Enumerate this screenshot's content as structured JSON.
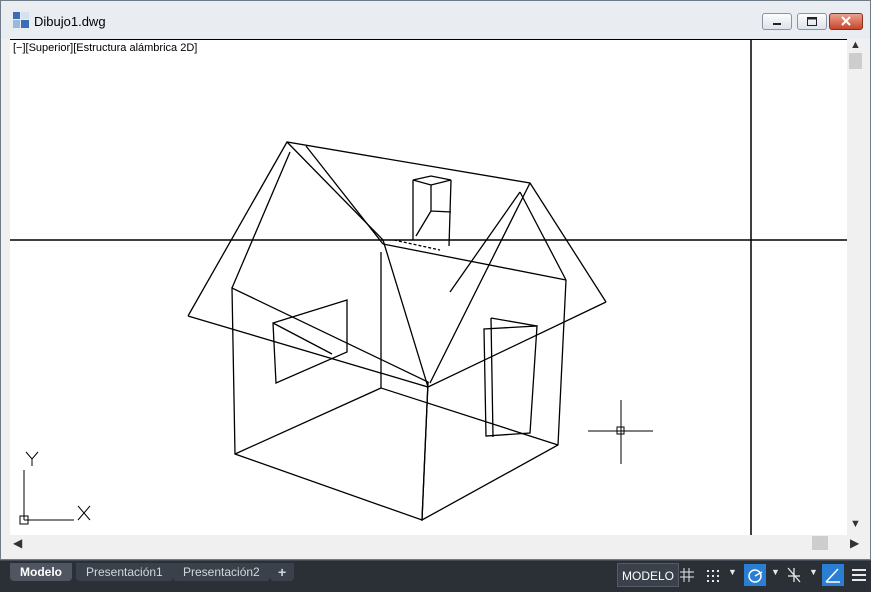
{
  "window": {
    "title": "Dibujo1.dwg",
    "icons": {
      "app": "autocad-drawing-icon",
      "minimize": "minimize-icon",
      "maximize": "maximize-icon",
      "close": "close-icon"
    }
  },
  "viewport": {
    "label": "[−][Superior][Estructura alámbrica 2D]",
    "content": "house-wireframe-drawing",
    "ucs": {
      "x_label": "X",
      "y_label": "Y"
    }
  },
  "scrollbars": {
    "up": "▲",
    "down": "▼",
    "left": "◀",
    "right": "▶"
  },
  "statusbar": {
    "tabs": [
      {
        "label": "Modelo",
        "active": true
      },
      {
        "label": "Presentación1",
        "active": false
      },
      {
        "label": "Presentación2",
        "active": false
      }
    ],
    "add_tab": "+",
    "model_button": "MODELO",
    "tools": [
      "grid-icon",
      "snap-icon",
      "ortho-icon",
      "polar-tracking-icon",
      "isodraft-icon",
      "customize-menu-icon"
    ]
  },
  "colors": {
    "accent": "#2a7fd4",
    "background": "#ffffff",
    "statusbar": "#2b2f36"
  }
}
